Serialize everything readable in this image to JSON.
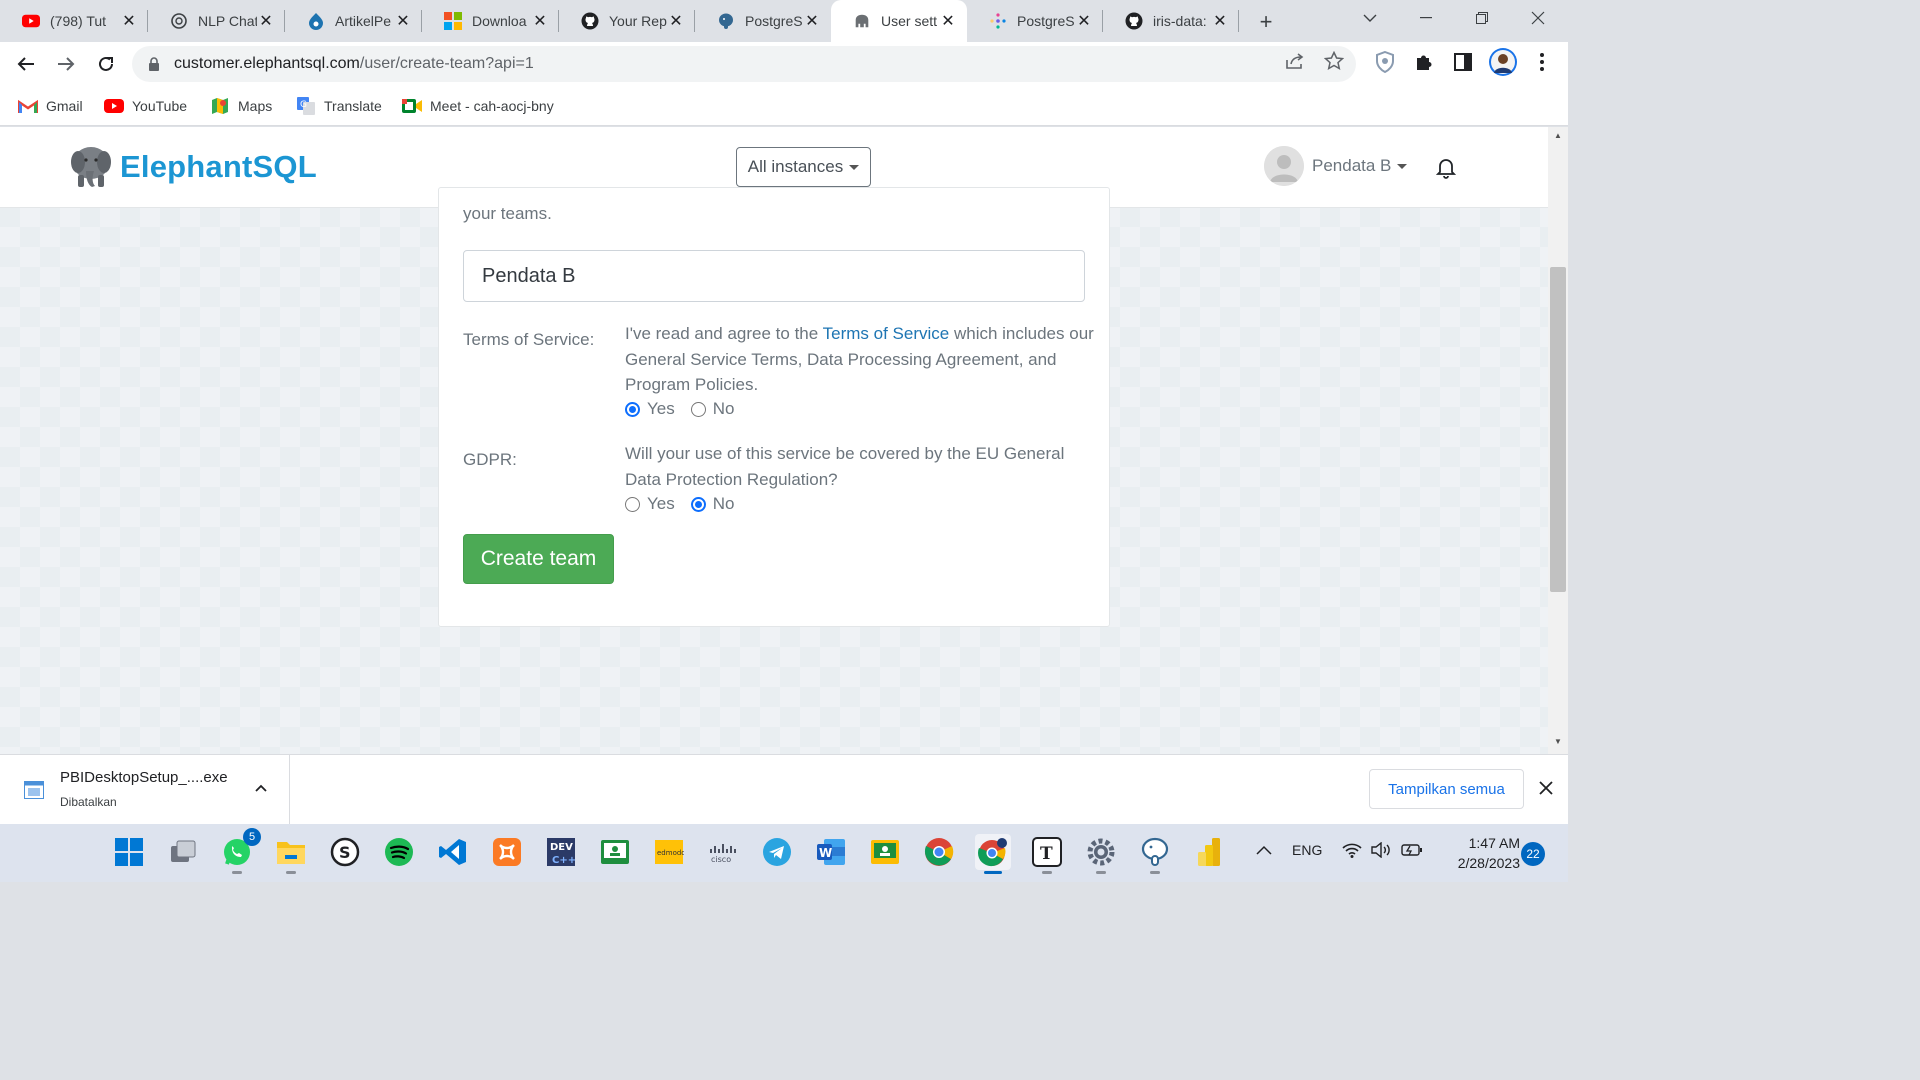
{
  "browser": {
    "tabs": [
      {
        "title": "(798) Tut",
        "icon": "youtube-icon",
        "active": false
      },
      {
        "title": "NLP Chat",
        "icon": "openai-icon",
        "active": false
      },
      {
        "title": "ArtikelPe",
        "icon": "drupal-icon",
        "active": false
      },
      {
        "title": "Downloa",
        "icon": "microsoft-icon",
        "active": false
      },
      {
        "title": "Your Rep",
        "icon": "github-icon",
        "active": false
      },
      {
        "title": "PostgreS",
        "icon": "postgresql-icon",
        "active": false
      },
      {
        "title": "User sett",
        "icon": "elephantsql-icon",
        "active": true
      },
      {
        "title": "PostgreS",
        "icon": "sparkle-icon",
        "active": false
      },
      {
        "title": "iris-data:",
        "icon": "github-icon",
        "active": false
      }
    ],
    "new_tab_label": "+",
    "url_host": "customer.elephantsql.com",
    "url_path": "/user/create-team?api=1",
    "bookmarks": [
      {
        "label": "Gmail",
        "icon": "gmail-icon"
      },
      {
        "label": "YouTube",
        "icon": "youtube-icon"
      },
      {
        "label": "Maps",
        "icon": "maps-icon"
      },
      {
        "label": "Translate",
        "icon": "translate-icon"
      },
      {
        "label": "Meet - cah-aocj-bny",
        "icon": "meet-icon"
      }
    ]
  },
  "site": {
    "brand": "ElephantSQL",
    "brand_color": "#1c96d3",
    "instances_label": "All instances",
    "user_name": "Pendata B"
  },
  "form": {
    "intro_tail": "your teams.",
    "team_name_value": "Pendata B",
    "tos_label": "Terms of Service:",
    "tos_text_before": "I've read and agree to the ",
    "tos_link": "Terms of Service",
    "tos_text_after": " which includes our General Service Terms, Data Processing Agreement, and Program Policies.",
    "tos_yes": "Yes",
    "tos_no": "No",
    "tos_selected": "Yes",
    "gdpr_label": "GDPR:",
    "gdpr_text": "Will your use of this service be covered by the EU General Data Protection Regulation?",
    "gdpr_yes": "Yes",
    "gdpr_no": "No",
    "gdpr_selected": "No",
    "submit_label": "Create team",
    "submit_color": "#4caa55"
  },
  "download": {
    "file_name": "PBIDesktopSetup_....exe",
    "status": "Dibatalkan",
    "show_all_label": "Tampilkan semua"
  },
  "taskbar": {
    "apps": [
      "start-icon",
      "task-view-icon",
      "whatsapp-icon",
      "file-explorer-icon",
      "skype-icon",
      "spotify-icon",
      "vscode-icon",
      "xampp-icon",
      "devcpp-icon",
      "google-classroom-icon",
      "edmodo-icon",
      "cisco-icon",
      "telegram-icon",
      "word-icon",
      "classroom-icon",
      "chrome-icon",
      "chrome-profile-icon",
      "typora-icon",
      "settings-icon",
      "pgadmin-icon",
      "powerbi-icon"
    ],
    "whatsapp_badge": "5",
    "language": "ENG",
    "time": "1:47 AM",
    "date": "2/28/2023",
    "notification_count": "22"
  }
}
